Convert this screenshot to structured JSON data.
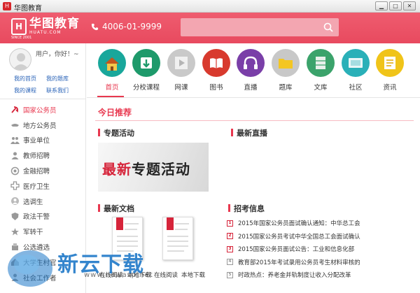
{
  "window": {
    "title": "华图教育",
    "app_icon": "h-logo-icon"
  },
  "header": {
    "logo_text": "华图教育",
    "logo_sub": "HUATU.COM",
    "logo_est": "SINCE 2001",
    "phone": "4006-01-9999",
    "search_placeholder": "",
    "brand_color": "#e84a5f"
  },
  "user": {
    "greeting": "用户，你好！~",
    "links": [
      "我的首页",
      "我的题库",
      "我的课程",
      "联系我们"
    ]
  },
  "sidebar": {
    "items": [
      {
        "label": "国家公务员",
        "icon": "party-emblem-icon",
        "active": true
      },
      {
        "label": "地方公务员",
        "icon": "hat-icon"
      },
      {
        "label": "事业单位",
        "icon": "people-icon"
      },
      {
        "label": "教师招聘",
        "icon": "teacher-icon"
      },
      {
        "label": "金融招聘",
        "icon": "coin-icon"
      },
      {
        "label": "医疗卫生",
        "icon": "cross-icon"
      },
      {
        "label": "选调生",
        "icon": "user-icon"
      },
      {
        "label": "政法干警",
        "icon": "badge-icon"
      },
      {
        "label": "军转干",
        "icon": "star-icon"
      },
      {
        "label": "公选遴选",
        "icon": "vote-icon"
      },
      {
        "label": "大学生村官",
        "icon": "village-icon"
      },
      {
        "label": "社会工作者",
        "icon": "worker-icon"
      }
    ]
  },
  "topnav": {
    "items": [
      {
        "label": "首页",
        "icon": "home-icon",
        "color": "#19a79b",
        "active": true
      },
      {
        "label": "分校课程",
        "icon": "download-icon",
        "color": "#1e9a6b"
      },
      {
        "label": "网课",
        "icon": "play-icon",
        "color": "#c9c9c9"
      },
      {
        "label": "图书",
        "icon": "book-icon",
        "color": "#d83a2e"
      },
      {
        "label": "直播",
        "icon": "headphones-icon",
        "color": "#7a3fa8"
      },
      {
        "label": "题库",
        "icon": "folder-icon",
        "color": "#c8c8c8"
      },
      {
        "label": "文库",
        "icon": "library-icon",
        "color": "#3ba36b"
      },
      {
        "label": "社区",
        "icon": "community-icon",
        "color": "#2ab0b8"
      },
      {
        "label": "资讯",
        "icon": "news-icon",
        "color": "#f0c419"
      }
    ]
  },
  "main": {
    "today": "今日推荐",
    "special": "专题活动",
    "live": "最新直播",
    "promo_a": "最新",
    "promo_b": "专题活动",
    "docs_title": "最新文档",
    "doc_labels": [
      "在线阅读",
      "本地下载",
      "在线阅读",
      "本地下载"
    ],
    "recruit_title": "招考信息",
    "news": [
      {
        "num": "1",
        "text": "2015年国家公务员面试确认通知：中华总工会"
      },
      {
        "num": "2",
        "text": "2015国家公务员考试中华全国总工会面试确认"
      },
      {
        "num": "3",
        "text": "2015国家公务员面试公告：工业和信息化部"
      },
      {
        "num": "4",
        "text": "教育部2015年考试录用公务员考生材料审核的"
      },
      {
        "num": "5",
        "text": "时政热点：养老金并轨制度让收入分配改革"
      }
    ]
  },
  "watermark": {
    "text": "新云下载",
    "url": "www.newasp.net"
  }
}
